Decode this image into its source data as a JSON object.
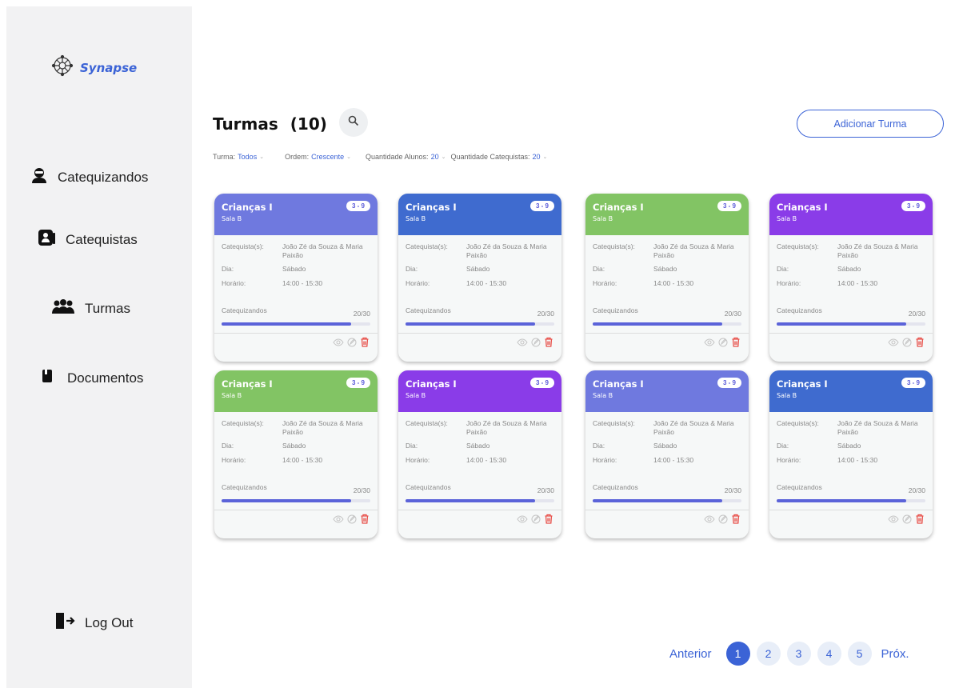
{
  "app": {
    "name": "Synapse",
    "brand_color": "#3b63d6"
  },
  "sidebar": {
    "items": [
      {
        "label": "Catequizandos",
        "icon": "student-icon"
      },
      {
        "label": "Catequistas",
        "icon": "teacher-icon"
      },
      {
        "label": "Turmas",
        "icon": "group-icon"
      },
      {
        "label": "Documentos",
        "icon": "document-icon"
      }
    ],
    "logout": {
      "label": "Log Out",
      "icon": "logout-icon"
    }
  },
  "header": {
    "title": "Turmas",
    "count": "(10)",
    "add_button": "Adicionar Turma"
  },
  "filters": [
    {
      "label": "Turma:",
      "value": "Todos"
    },
    {
      "label": "Ordem:",
      "value": "Crescente"
    },
    {
      "label": "Quantidade Alunos:",
      "value": "20"
    },
    {
      "label": "Quantidade Catequistas:",
      "value": "20"
    }
  ],
  "card_labels": {
    "catequistas": "Catequista(s):",
    "dia": "Dia:",
    "horario": "Horário:",
    "catequizandos": "Catequizandos"
  },
  "cards": [
    {
      "title": "Crianças I",
      "room": "Sala B",
      "ages": "3 - 9",
      "teachers": "João Zé da Souza & Maria Paixão",
      "day": "Sábado",
      "time": "14:00 - 15:30",
      "enrolled": "20/30",
      "fill": 0.87,
      "color": "#6f79df"
    },
    {
      "title": "Crianças I",
      "room": "Sala B",
      "ages": "3 - 9",
      "teachers": "João Zé da Souza & Maria Paixão",
      "day": "Sábado",
      "time": "14:00 - 15:30",
      "enrolled": "20/30",
      "fill": 0.87,
      "color": "#3f6bcf"
    },
    {
      "title": "Crianças I",
      "room": "Sala B",
      "ages": "3 - 9",
      "teachers": "João Zé da Souza & Maria Paixão",
      "day": "Sábado",
      "time": "14:00 - 15:30",
      "enrolled": "20/30",
      "fill": 0.87,
      "color": "#82c464"
    },
    {
      "title": "Crianças I",
      "room": "Sala B",
      "ages": "3 - 9",
      "teachers": "João Zé da Souza & Maria Paixão",
      "day": "Sábado",
      "time": "14:00 - 15:30",
      "enrolled": "20/30",
      "fill": 0.87,
      "color": "#8a3ce8"
    },
    {
      "title": "Crianças I",
      "room": "Sala B",
      "ages": "3 - 9",
      "teachers": "João Zé da Souza & Maria Paixão",
      "day": "Sábado",
      "time": "14:00 - 15:30",
      "enrolled": "20/30",
      "fill": 0.87,
      "color": "#82c464"
    },
    {
      "title": "Crianças I",
      "room": "Sala B",
      "ages": "3 - 9",
      "teachers": "João Zé da Souza & Maria Paixão",
      "day": "Sábado",
      "time": "14:00 - 15:30",
      "enrolled": "20/30",
      "fill": 0.87,
      "color": "#8a3ce8"
    },
    {
      "title": "Crianças I",
      "room": "Sala B",
      "ages": "3 - 9",
      "teachers": "João Zé da Souza & Maria Paixão",
      "day": "Sábado",
      "time": "14:00 - 15:30",
      "enrolled": "20/30",
      "fill": 0.87,
      "color": "#6f79df"
    },
    {
      "title": "Crianças I",
      "room": "Sala B",
      "ages": "3 - 9",
      "teachers": "João Zé da Souza & Maria Paixão",
      "day": "Sábado",
      "time": "14:00 - 15:30",
      "enrolled": "20/30",
      "fill": 0.87,
      "color": "#3f6bcf"
    }
  ],
  "pagination": {
    "prev": "Anterior",
    "next": "Próx.",
    "pages": [
      "1",
      "2",
      "3",
      "4",
      "5"
    ],
    "current": "1"
  }
}
